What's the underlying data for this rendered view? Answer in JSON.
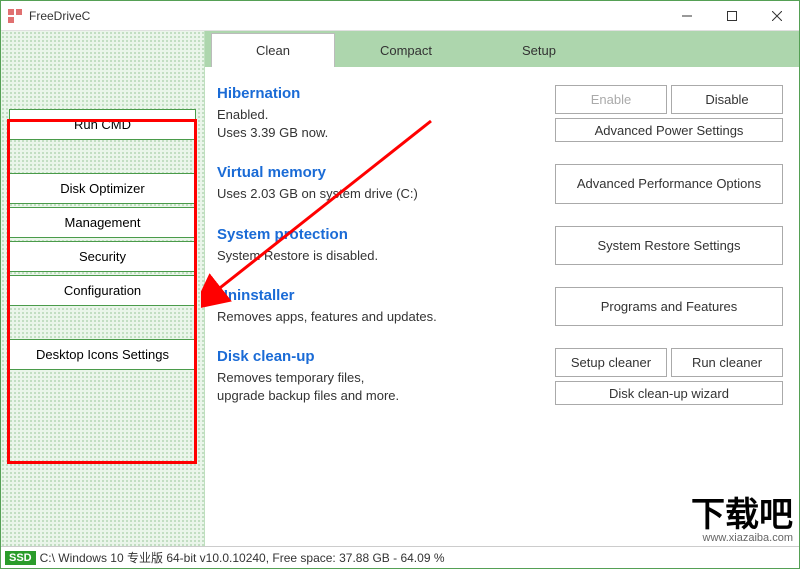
{
  "window": {
    "title": "FreeDriveC"
  },
  "sidebar": {
    "items": [
      "Run CMD",
      "Disk Optimizer",
      "Management",
      "Security",
      "Configuration",
      "Desktop Icons Settings"
    ]
  },
  "tabs": {
    "items": [
      "Clean",
      "Compact",
      "Setup"
    ],
    "active": 0
  },
  "sections": {
    "hibernation": {
      "title": "Hibernation",
      "line1": "Enabled.",
      "line2": "Uses 3.39 GB now.",
      "enable": "Enable",
      "disable": "Disable",
      "adv": "Advanced Power Settings"
    },
    "vmem": {
      "title": "Virtual memory",
      "desc": "Uses 2.03 GB on system drive (C:)",
      "adv": "Advanced Performance Options"
    },
    "sysprot": {
      "title": "System protection",
      "desc": "System Restore is disabled.",
      "btn": "System Restore Settings"
    },
    "uninst": {
      "title": "Uninstaller",
      "desc": "Removes apps, features and updates.",
      "btn": "Programs and Features"
    },
    "cleanup": {
      "title": "Disk clean-up",
      "line1": "Removes temporary files,",
      "line2": "upgrade backup files and more.",
      "setup": "Setup cleaner",
      "run": "Run cleaner",
      "wizard": "Disk clean-up wizard"
    }
  },
  "status": {
    "ssd": "SSD",
    "text": "C:\\ Windows 10 专业版 64-bit v10.0.10240, Free space: 37.88 GB - 64.09 %"
  },
  "watermark": {
    "big": "下载吧",
    "url": "www.xiazaiba.com"
  }
}
